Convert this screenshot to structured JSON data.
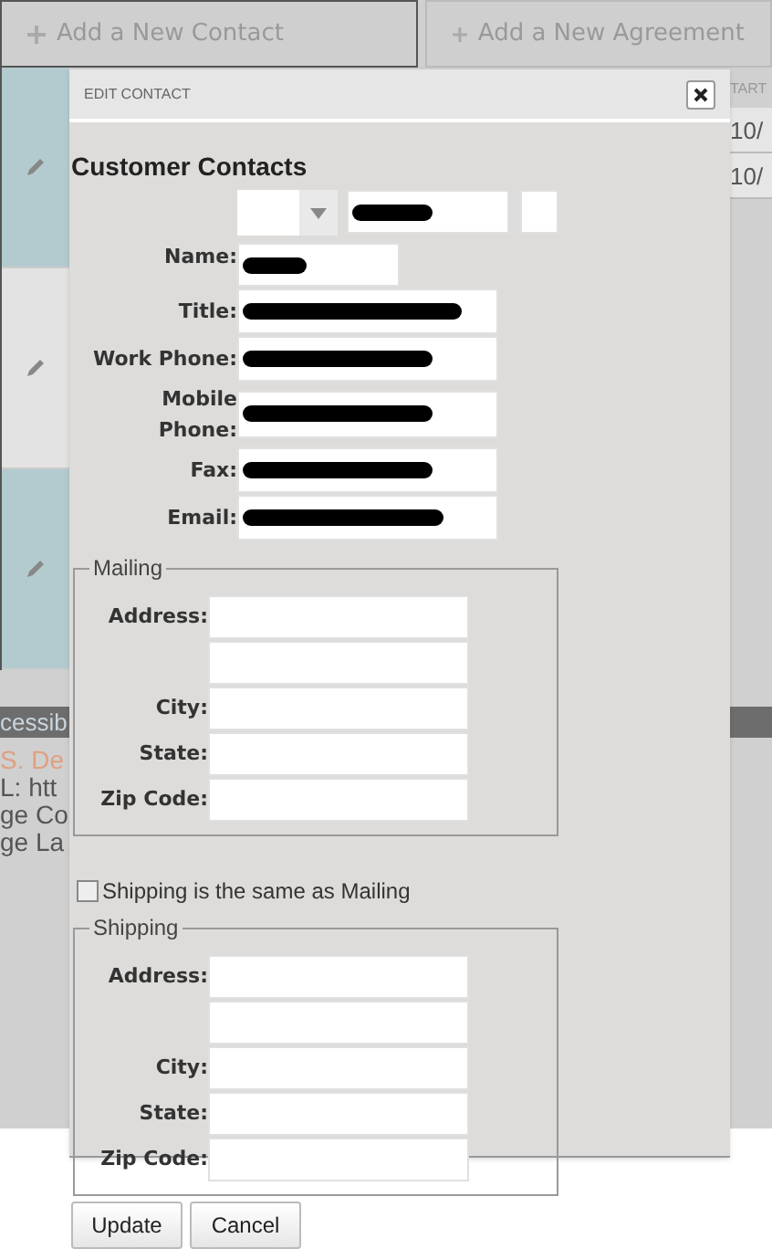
{
  "background_page": {
    "tabs": [
      {
        "label": "Add a New Contact",
        "selected": true
      },
      {
        "label": "Add a New Agreement",
        "selected": false
      }
    ],
    "rows": [
      {
        "highlighted": true
      },
      {
        "highlighted": false
      },
      {
        "highlighted": true
      }
    ],
    "table_header": "TART",
    "table_cells": [
      "10/",
      "10/"
    ],
    "section_bar": "cessib",
    "section_lines": [
      {
        "text": "S. De",
        "kind": "link"
      },
      {
        "text": "L: htt",
        "kind": "text"
      },
      {
        "text": "ge Co",
        "kind": "text"
      },
      {
        "text": "ge La",
        "kind": "text"
      }
    ]
  },
  "dialog": {
    "title": "EDIT CONTACT",
    "heading": "Customer Contacts",
    "name": {
      "label": "Name:",
      "first_redacted": true,
      "last_redacted": true
    },
    "fields": [
      {
        "label": "Title:",
        "redacted": true
      },
      {
        "label": "Work Phone:",
        "redacted": true
      },
      {
        "label": "Mobile Phone:",
        "redacted": true
      },
      {
        "label": "Fax:",
        "redacted": true
      },
      {
        "label": "Email:",
        "redacted": true
      }
    ],
    "mailing": {
      "legend": "Mailing",
      "rows": [
        {
          "label": "Address:"
        },
        {},
        {
          "label": "City:"
        },
        {
          "label": "State:"
        },
        {
          "label": "Zip Code:"
        }
      ]
    },
    "same_as_mailing": {
      "label": "Shipping is the same as Mailing",
      "checked": false
    },
    "shipping": {
      "legend": "Shipping",
      "rows": [
        {
          "label": "Address:"
        },
        {},
        {
          "label": "City:"
        },
        {
          "label": "State:"
        },
        {
          "label": "Zip Code:"
        }
      ]
    },
    "buttons": [
      "Update",
      "Cancel"
    ]
  }
}
